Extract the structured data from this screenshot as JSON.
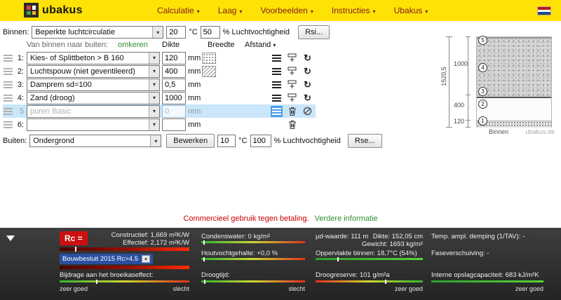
{
  "topbar": {
    "logo": "ubakus",
    "menus": [
      "Calculatie",
      "Laag",
      "Voorbeelden",
      "Instructies",
      "Ubakus"
    ]
  },
  "icons": {
    "rotate": "↻"
  },
  "binnen_row": {
    "label": "Binnen:",
    "climate_select": "Beperkte luchtcirculatie",
    "temp_value": "20",
    "temp_unit": "°C",
    "humidity_value": "50",
    "humidity_unit": "% Luchtvochtigheid",
    "rsi_button": "Rsi..."
  },
  "layers": {
    "direction_label": "Van binnen naar buiten:",
    "omkeren_link": "omkeren",
    "col_dikte": "Dikte",
    "col_breedte": "Breedte",
    "col_afstand": "Afstand",
    "rows": [
      {
        "number": "1:",
        "material": "Kies- of Splittbeton > B 160",
        "dikte": "120",
        "unit": "mm"
      },
      {
        "number": "2:",
        "material": "Luchtspouw (niet geventileerd)",
        "dikte": "400",
        "unit": "mm"
      },
      {
        "number": "3:",
        "material": "Damprem sd=100",
        "dikte": "0,5",
        "unit": "mm"
      },
      {
        "number": "4:",
        "material": "Zand (droog)",
        "dikte": "1000",
        "unit": "mm"
      },
      {
        "number": "5",
        "material": "puren Basic",
        "dikte": "0",
        "unit": "mm"
      },
      {
        "number": "6:",
        "material": "",
        "dikte": "",
        "unit": "mm"
      }
    ]
  },
  "buiten_row": {
    "label": "Buiten:",
    "select": "Ondergrond",
    "bewerken_button": "Bewerken",
    "temp_value": "10",
    "temp_unit": "°C",
    "humidity_value": "100",
    "humidity_unit": "% Luchtvochtigheid",
    "rse_button": "Rse..."
  },
  "diagram": {
    "total_dim": "1520,5",
    "segment_dims": [
      "1000",
      "400",
      "120"
    ],
    "layer_markers": [
      "5",
      "4",
      "3",
      "2",
      "1"
    ],
    "binnen_label": "Binnen",
    "watermark": "ubakus.de"
  },
  "notice": {
    "warning": "Commercieel gebruik tegen betaling.",
    "link": "Verdere informatie"
  },
  "results": {
    "rc": {
      "label": "Rc =",
      "constructief": "Constructief: 1,669 m²K/W",
      "effectief": "Effectief: 2,172 m²K/W",
      "bouwbesluit": "Bouwbesluit 2015 Rc>4.5",
      "broeikaseffect_label": "Bijdrage aan het broeikaseffect:",
      "scale_left": "zeer goed",
      "scale_right": "slecht"
    },
    "moisture": {
      "condenswater": "Condenswater: 0 kg/m²",
      "houtvochtgehalte": "Houtvochtgehalte: +0,0 %",
      "droogtijd": "Droogtijd:",
      "scale_right": "slecht"
    },
    "physical": {
      "ud_waarde": "µd-waarde: 111 m",
      "dikte": "Dikte: 152,05 cm",
      "gewicht": "Gewicht: 1693 kg/m²",
      "oppervlakte": "Oppervlakte binnen: 18,7°C (54%)",
      "droogreserve": "Droogreserve: 101 g/m²a",
      "scale_right": "zeer goed"
    },
    "thermal": {
      "temp_demping": "Temp. ampl. demping (1/TAV): -",
      "faseverschuiving": "Faseverschuiving: -",
      "opslagcapaciteit": "Interne opslagcapaciteit: 683 kJ/m²K",
      "scale_right": "zeer goed"
    }
  }
}
